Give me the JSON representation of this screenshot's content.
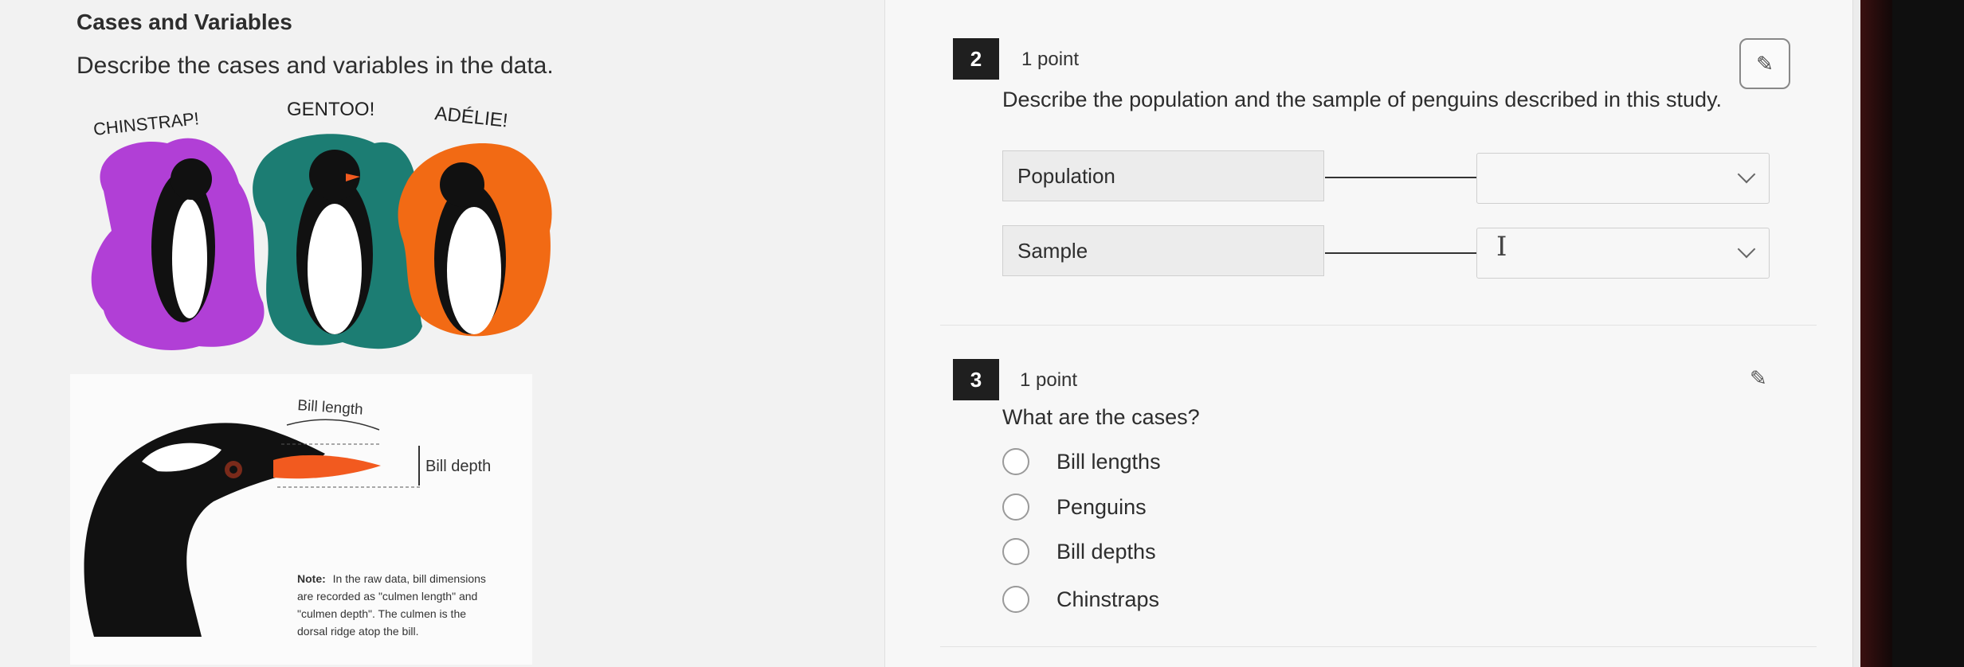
{
  "left": {
    "title": "Cases and Variables",
    "description": "Describe the cases and variables in the data.",
    "penguin_labels": [
      "CHINSTRAP!",
      "GENTOO!",
      "ADÉLIE!"
    ],
    "bill_figure": {
      "length_label": "Bill length",
      "depth_label": "Bill depth",
      "note_heading": "Note:",
      "note_lines": [
        "In the raw data, bill dimensions",
        "are recorded as \"culmen length\" and",
        "\"culmen depth\". The culmen is the",
        "dorsal ridge atop the bill."
      ]
    }
  },
  "questions": [
    {
      "number": "2",
      "points": "1 point",
      "prompt": "Describe the population and the sample of penguins described in this study.",
      "pin_icon": "pin-icon",
      "matches": [
        {
          "label": "Population",
          "value": ""
        },
        {
          "label": "Sample",
          "value": ""
        }
      ]
    },
    {
      "number": "3",
      "points": "1 point",
      "prompt": "What are the cases?",
      "pin_icon": "pin-icon",
      "options": [
        "Bill lengths",
        "Penguins",
        "Bill depths",
        "Chinstraps"
      ]
    }
  ],
  "colors": {
    "chinstrap": "#b13fd6",
    "gentoo": "#1c7d73",
    "adelie": "#f26a14",
    "beak": "#f25a1f"
  }
}
